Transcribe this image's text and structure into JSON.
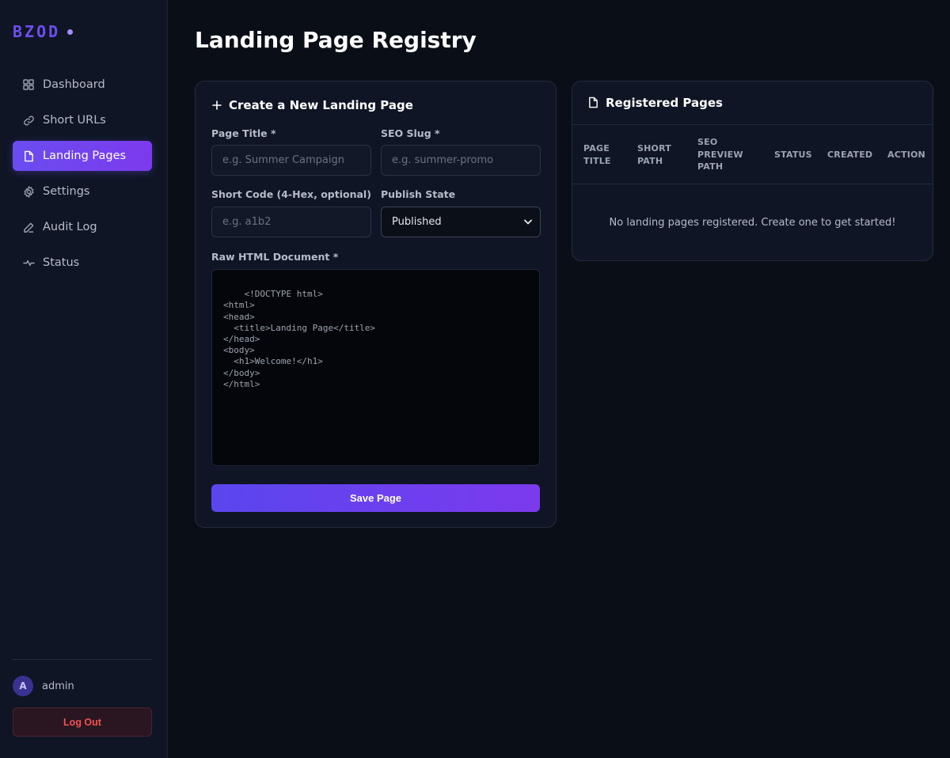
{
  "brand": {
    "name": "BZOD"
  },
  "sidebar": {
    "items": [
      {
        "label": "Dashboard",
        "icon": "grid-icon"
      },
      {
        "label": "Short URLs",
        "icon": "link-icon"
      },
      {
        "label": "Landing Pages",
        "icon": "file-icon",
        "active": true
      },
      {
        "label": "Settings",
        "icon": "gear-icon"
      },
      {
        "label": "Audit Log",
        "icon": "pencil-icon"
      },
      {
        "label": "Status",
        "icon": "pulse-icon"
      }
    ],
    "user": {
      "initial": "A",
      "name": "admin"
    },
    "logout_label": "Log Out"
  },
  "page": {
    "title": "Landing Page Registry"
  },
  "create_form": {
    "title": "Create a New Landing Page",
    "page_title_label": "Page Title *",
    "page_title_placeholder": "e.g. Summer Campaign",
    "slug_label": "SEO Slug *",
    "slug_placeholder": "e.g. summer-promo",
    "short_code_label": "Short Code (4-Hex, optional)",
    "short_code_placeholder": "e.g. a1b2",
    "publish_label": "Publish State",
    "publish_value": "Published",
    "html_label": "Raw HTML Document *",
    "html_value": "<!DOCTYPE html>\n<html>\n<head>\n  <title>Landing Page</title>\n</head>\n<body>\n  <h1>Welcome!</h1>\n</body>\n</html>",
    "save_label": "Save Page"
  },
  "registered": {
    "title": "Registered Pages",
    "columns": [
      "PAGE\nTITLE",
      "SHORT\nPATH",
      "SEO\nPREVIEW\nPATH",
      "STATUS",
      "CREATED",
      "ACTION"
    ],
    "empty_message": "No landing pages registered. Create one to get started!"
  },
  "colors": {
    "accent": "#6d4ff0",
    "accent_end": "#7c3aed",
    "danger": "#f05252",
    "background": "#0a0e17",
    "panel": "#0f1524"
  }
}
